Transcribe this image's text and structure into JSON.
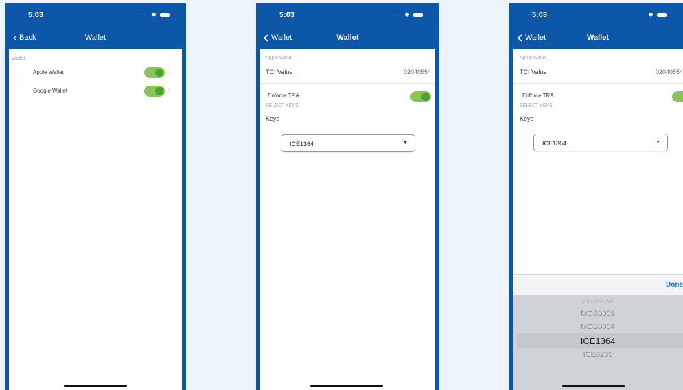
{
  "status": {
    "time": "5:03"
  },
  "screen1": {
    "back_label": "Back",
    "title": "Wallet",
    "section": "Wallet",
    "rows": [
      {
        "label": "Apple Wallet"
      },
      {
        "label": "Google Wallet"
      }
    ]
  },
  "screen2": {
    "back_label": "Wallet",
    "title": "Wallet",
    "section": "Apple Wallet",
    "tci_label": "TCI Value",
    "tci_value": "02040554",
    "enforce_label": "Enforce TRA",
    "select_keys_label": "SELECT KEYS",
    "keys_label": "Keys",
    "selected_key": "ICE1364"
  },
  "screen3": {
    "back_label": "Wallet",
    "title": "Wallet",
    "section": "Apple Wallet",
    "tci_label": "TCI Value",
    "tci_value": "02040554",
    "enforce_label": "Enforce TRA",
    "select_keys_label": "SELECT KEYS",
    "keys_label": "Keys",
    "selected_key": "ICE1364",
    "done_label": "Done",
    "picker_options": [
      "SELECT KEYS",
      "MOB0001",
      "MOB0004",
      "ICE1364",
      "ICE0235"
    ]
  },
  "colors": {
    "nav": "#0d57a8",
    "toggle_on": "#46a630",
    "done": "#1a73e8"
  }
}
